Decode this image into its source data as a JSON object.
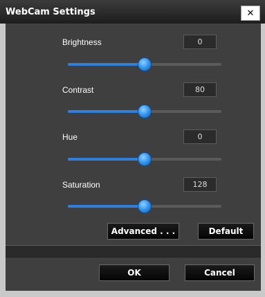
{
  "window": {
    "title": "WebCam Settings",
    "close_glyph": "✕"
  },
  "controls": [
    {
      "label": "Brightness",
      "value": "0",
      "slider_fraction": 0.5
    },
    {
      "label": "Contrast",
      "value": "80",
      "slider_fraction": 0.5
    },
    {
      "label": "Hue",
      "value": "0",
      "slider_fraction": 0.5
    },
    {
      "label": "Saturation",
      "value": "128",
      "slider_fraction": 0.5
    }
  ],
  "buttons": {
    "advanced": "Advanced . . .",
    "default": "Default",
    "ok": "OK",
    "cancel": "Cancel"
  },
  "colors": {
    "accent": "#2f7fe0",
    "panel": "#3f3f3f",
    "titlebar": "#1d1d1d"
  }
}
